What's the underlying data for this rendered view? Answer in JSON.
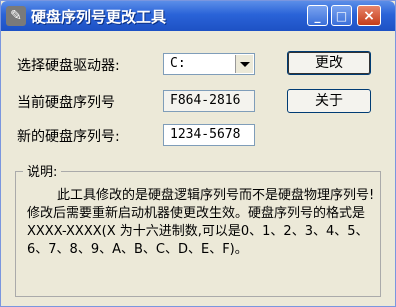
{
  "window": {
    "title": "硬盘序列号更改工具",
    "min_label": "_",
    "max_label": "□",
    "close_label": "×"
  },
  "form": {
    "drive_label": "选择硬盘驱动器:",
    "drive_value": "C:",
    "current_serial_label": "当前硬盘序列号",
    "current_serial_value": "F864-2816",
    "new_serial_label": "新的硬盘序列号:",
    "new_serial_value": "1234-5678"
  },
  "buttons": {
    "change_label": "更改",
    "about_label": "关于"
  },
  "info": {
    "group_label": "说明:",
    "text": "此工具修改的是硬盘逻辑序列号而不是硬盘物理序列号!修改后需要重新启动机器使更改生效。硬盘序列号的格式是 XXXX-XXXX(X 为十六进制数,可以是0、1、2、3、4、5、6、7、8、9、A、B、C、D、E、F)。"
  }
}
